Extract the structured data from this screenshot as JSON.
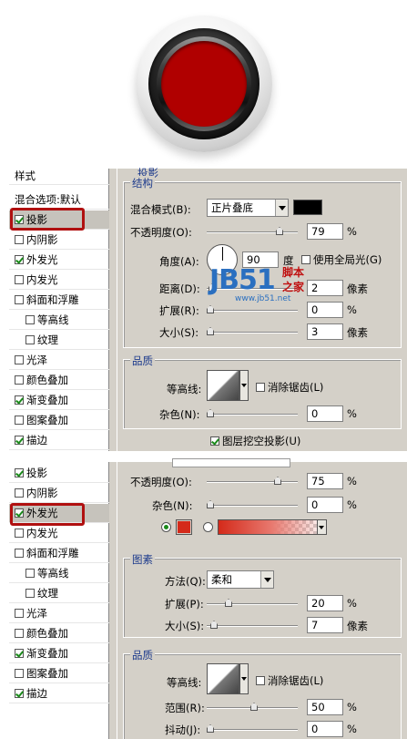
{
  "panel1": {
    "header": "样式",
    "blend_options": "混合选项:默认",
    "cut_title": "投影",
    "sidebar": [
      {
        "label": "投影",
        "checked": true,
        "selected": true
      },
      {
        "label": "内阴影",
        "checked": false
      },
      {
        "label": "外发光",
        "checked": true
      },
      {
        "label": "内发光",
        "checked": false
      },
      {
        "label": "斜面和浮雕",
        "checked": false
      },
      {
        "label": "等高线",
        "checked": false
      },
      {
        "label": "纹理",
        "checked": false
      },
      {
        "label": "光泽",
        "checked": false
      },
      {
        "label": "颜色叠加",
        "checked": false
      },
      {
        "label": "渐变叠加",
        "checked": true
      },
      {
        "label": "图案叠加",
        "checked": false
      },
      {
        "label": "描边",
        "checked": true
      }
    ],
    "structure": {
      "title": "结构",
      "blend_mode_label": "混合模式(B):",
      "blend_mode_value": "正片叠底",
      "opacity_label": "不透明度(O):",
      "opacity_value": "79",
      "percent": "%",
      "angle_label": "角度(A):",
      "angle_value": "90",
      "angle_unit": "度",
      "global_light": "使用全局光(G)",
      "distance_label": "距离(D):",
      "distance_value": "2",
      "px": "像素",
      "spread_label": "扩展(R):",
      "spread_value": "0",
      "size_label": "大小(S):",
      "size_value": "3"
    },
    "quality": {
      "title": "品质",
      "contour_label": "等高线:",
      "antialias": "消除锯齿(L)",
      "noise_label": "杂色(N):",
      "noise_value": "0",
      "knockout": "图层挖空投影(U)"
    }
  },
  "watermark": {
    "logo": "JB51",
    "cn_top": "脚本",
    "cn_bottom": "之家",
    "url": "www.jb51.net"
  },
  "panel2": {
    "sidebar": [
      {
        "label": "投影",
        "checked": true
      },
      {
        "label": "内阴影",
        "checked": false
      },
      {
        "label": "外发光",
        "checked": true,
        "selected": true
      },
      {
        "label": "内发光",
        "checked": false
      },
      {
        "label": "斜面和浮雕",
        "checked": false
      },
      {
        "label": "等高线",
        "checked": false
      },
      {
        "label": "纹理",
        "checked": false
      },
      {
        "label": "光泽",
        "checked": false
      },
      {
        "label": "颜色叠加",
        "checked": false
      },
      {
        "label": "渐变叠加",
        "checked": true
      },
      {
        "label": "图案叠加",
        "checked": false
      },
      {
        "label": "描边",
        "checked": true
      }
    ],
    "structure": {
      "opacity_label": "不透明度(O):",
      "opacity_value": "75",
      "noise_label": "杂色(N):",
      "noise_value": "0",
      "percent": "%"
    },
    "elements": {
      "title": "图素",
      "method_label": "方法(Q):",
      "method_value": "柔和",
      "spread_label": "扩展(P):",
      "spread_value": "20",
      "size_label": "大小(S):",
      "size_value": "7",
      "px": "像素"
    },
    "quality": {
      "title": "品质",
      "contour_label": "等高线:",
      "antialias": "消除锯齿(L)",
      "range_label": "范围(R):",
      "range_value": "50",
      "jitter_label": "抖动(J):",
      "jitter_value": "0"
    }
  },
  "colors": {
    "glow": "#d42a1a",
    "button_red": "#b00000",
    "highlight": "#b01010",
    "section_title": "#1c3a8c"
  }
}
